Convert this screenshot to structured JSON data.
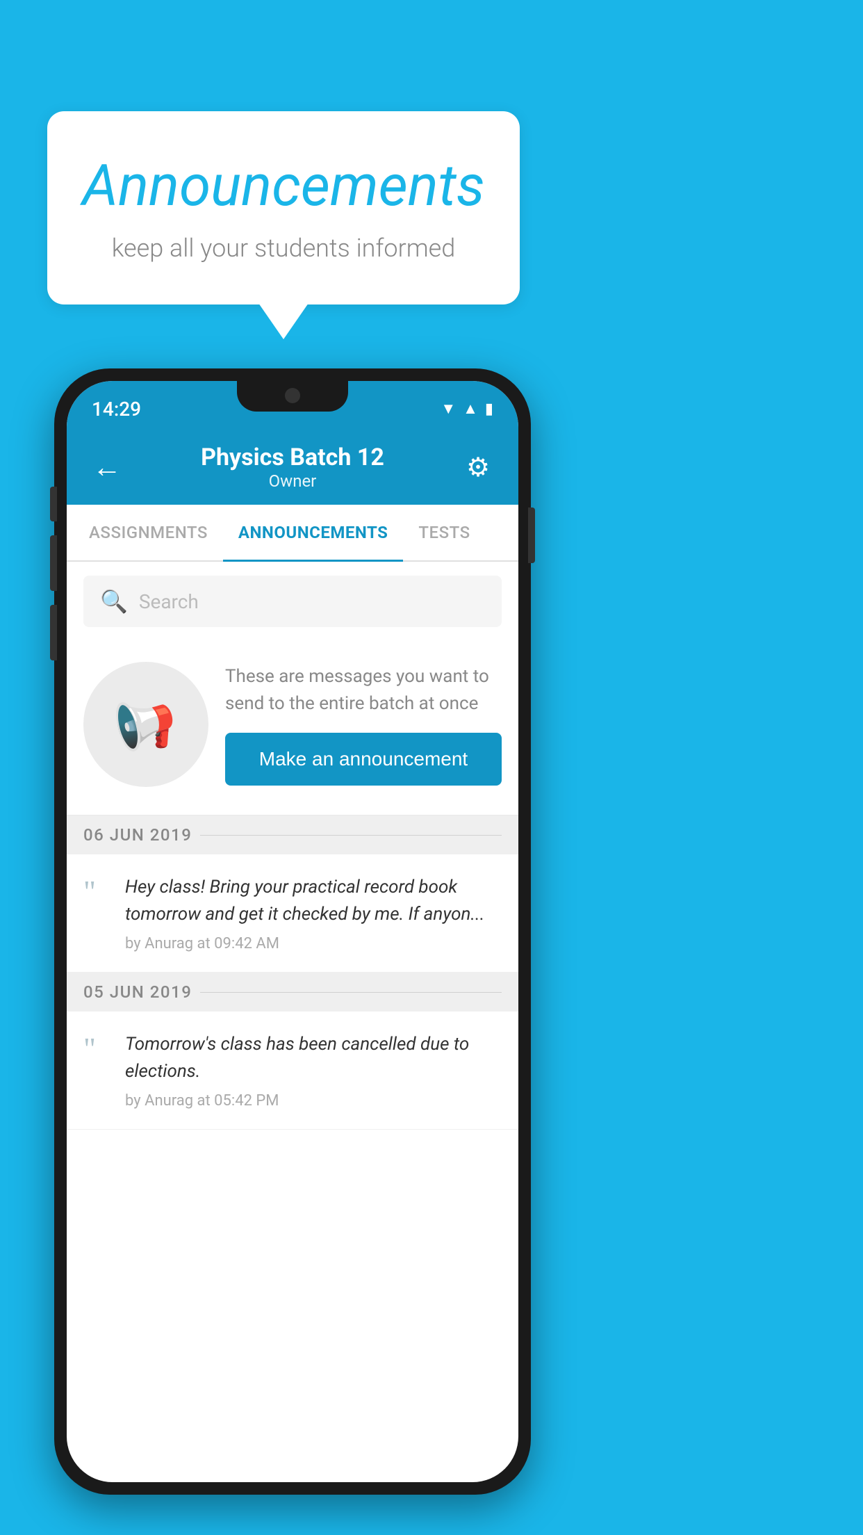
{
  "bubble": {
    "title": "Announcements",
    "subtitle": "keep all your students informed"
  },
  "phone": {
    "status_bar": {
      "time": "14:29",
      "icons": [
        "wifi",
        "signal",
        "battery"
      ]
    },
    "header": {
      "title": "Physics Batch 12",
      "subtitle": "Owner",
      "back_label": "←",
      "gear_label": "⚙"
    },
    "tabs": [
      {
        "label": "ASSIGNMENTS",
        "active": false
      },
      {
        "label": "ANNOUNCEMENTS",
        "active": true
      },
      {
        "label": "TESTS",
        "active": false
      }
    ],
    "search": {
      "placeholder": "Search"
    },
    "promo": {
      "description": "These are messages you want to send to the entire batch at once",
      "button_label": "Make an announcement"
    },
    "announcements": [
      {
        "date": "06  JUN  2019",
        "items": [
          {
            "text": "Hey class! Bring your practical record book tomorrow and get it checked by me. If anyon...",
            "meta": "by Anurag at 09:42 AM"
          }
        ]
      },
      {
        "date": "05  JUN  2019",
        "items": [
          {
            "text": "Tomorrow's class has been cancelled due to elections.",
            "meta": "by Anurag at 05:42 PM"
          }
        ]
      }
    ]
  }
}
